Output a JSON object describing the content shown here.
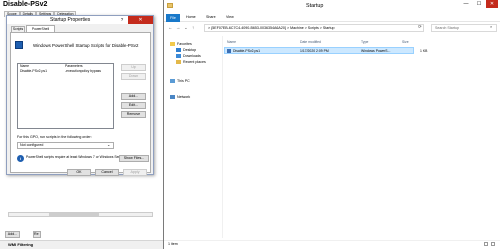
{
  "gpo_pane": {
    "title": "Disable-PSv2",
    "tabs": [
      "Scope",
      "Details",
      "Settings",
      "Delegation"
    ],
    "add_button": "Add...",
    "partial_button": "Re",
    "wmi_label": "WMI Filtering"
  },
  "dialog": {
    "title": "Startup Properties",
    "help_glyph": "?",
    "close_glyph": "✕",
    "tabs": [
      "Scripts",
      "PowerShell Scripts"
    ],
    "heading": "Windows PowerShell Startup Scripts for Disable-PSv2",
    "list_headers": [
      "Name",
      "Parameters"
    ],
    "list_rows": [
      [
        "Disable-PSv2.ps1",
        "-executionpolicy bypass"
      ]
    ],
    "side_buttons": {
      "up": "Up",
      "down": "Down",
      "add": "Add...",
      "edit": "Edit...",
      "remove": "Remove"
    },
    "order_label": "For this GPO, run scripts in the following order:",
    "order_value": "Not configured",
    "info_text": "PowerShell scripts require at least Windows 7 or Windows Server 2008 R2",
    "show_files": "Show Files...",
    "ok": "OK",
    "cancel": "Cancel",
    "apply": "Apply"
  },
  "explorer": {
    "title": "Startup",
    "minimize": "—",
    "maximize": "☐",
    "close": "✕",
    "ribbon_tabs": [
      "File",
      "Home",
      "Share",
      "View"
    ],
    "address": "> {5EF07EB-6C7C4-4090-B653-0036354A6A20}  >  Machine  >  Scripts  >  Startup",
    "search_placeholder": "Search Startup",
    "nav": {
      "favorites": "Favorites",
      "desktop": "Desktop",
      "downloads": "Downloads",
      "recent": "Recent places",
      "this_pc": "This PC",
      "network": "Network"
    },
    "columns": [
      "Name",
      "Date modified",
      "Type",
      "Size"
    ],
    "files": [
      {
        "name": "Disable-PSv2.ps1",
        "date": "1/17/2020 2:09 PM",
        "type": "Windows PowerS...",
        "size": "1 KB"
      }
    ],
    "status": "1 item"
  }
}
